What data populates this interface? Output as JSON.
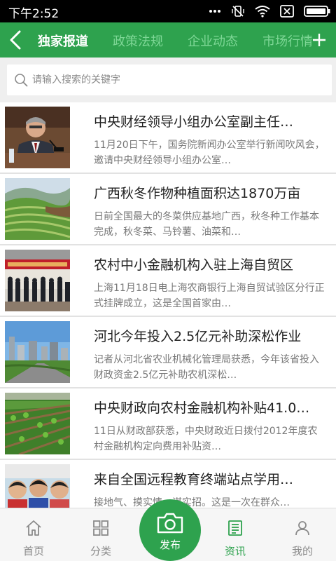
{
  "status_bar": {
    "time": "下午2:52",
    "icons": [
      "more-dots-icon",
      "vibrate-mute-icon",
      "wifi-icon",
      "sim-off-icon",
      "battery-icon"
    ]
  },
  "header": {
    "tabs": [
      {
        "label": "独家报道",
        "active": true
      },
      {
        "label": "政策法规",
        "active": false
      },
      {
        "label": "企业动态",
        "active": false
      },
      {
        "label": "市场行情",
        "active": false
      }
    ],
    "back_icon": "back-arrow-icon",
    "add_icon": "plus-icon"
  },
  "search": {
    "placeholder": "请输入搜索的关键字",
    "value": ""
  },
  "news": [
    {
      "title": "中央财经领导小组办公室副主任…",
      "desc": "11月20日下午，国务院新闻办公室举行新闻吹风会，邀请中央财经领导小组办公室…"
    },
    {
      "title": "广西秋冬作物种植面积达1870万亩",
      "desc": "日前全国最大的冬菜供应基地广西，秋冬种工作基本完成，秋冬菜、马铃薯、油菜和…"
    },
    {
      "title": "农村中小金融机构入驻上海自贸区",
      "desc": "上海11月18日电上海农商银行上海自贸试验区分行正式挂牌成立，这是全国首家由…"
    },
    {
      "title": "河北今年投入2.5亿元补助深松作业",
      "desc": "记者从河北省农业机械化管理局获悉，今年该省投入财政资金2.5亿元补助农机深松…"
    },
    {
      "title": "中央财政向农村金融机构补贴41.0…",
      "desc": "11日从财政部获悉，中央财政近日拨付2012年度农村金融机构定向费用补贴资…"
    },
    {
      "title": "来自全国远程教育终端站点学用…",
      "desc": "接地气、摸实情、谋实招。这是一次在群众…"
    }
  ],
  "bottom_nav": {
    "items": [
      {
        "label": "首页",
        "icon": "home-icon"
      },
      {
        "label": "分类",
        "icon": "grid-icon"
      },
      {
        "label": "资讯",
        "icon": "news-icon",
        "active": true
      },
      {
        "label": "我的",
        "icon": "user-icon"
      }
    ],
    "publish": {
      "label": "发布",
      "icon": "camera-icon"
    }
  },
  "colors": {
    "brand_green": "#2ea24e",
    "inactive_tab": "#7ed796",
    "status_bar": "#000000"
  }
}
